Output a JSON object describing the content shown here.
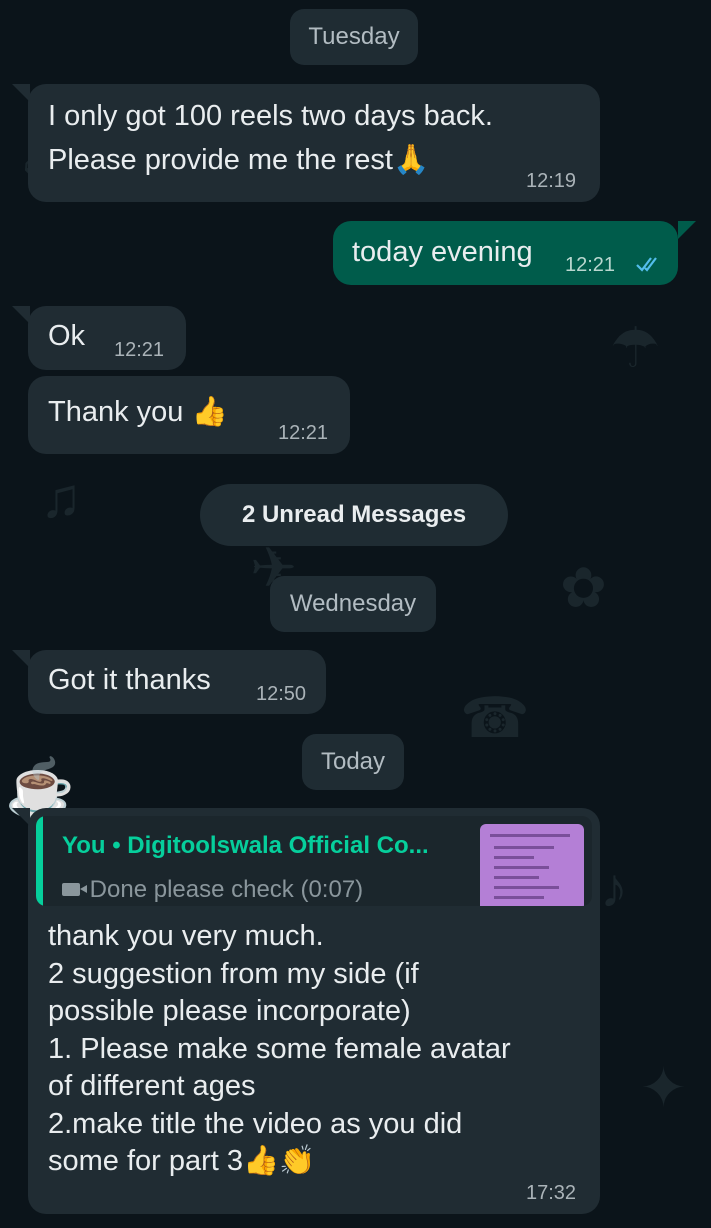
{
  "chat": {
    "date_tuesday": "Tuesday",
    "msg1": {
      "line1": "I only got 100 reels two days back.",
      "line2": "Please provide me the rest🙏",
      "time": "12:19"
    },
    "msg2": {
      "text": "today evening",
      "time": "12:21",
      "status_icon": "double-check-icon"
    },
    "msg3": {
      "text": "Ok",
      "time": "12:21"
    },
    "msg4": {
      "text": "Thank you 👍",
      "time": "12:21"
    },
    "unread_banner": "2 Unread Messages",
    "date_wednesday": "Wednesday",
    "msg5": {
      "text": "Got it thanks",
      "time": "12:50"
    },
    "date_today": "Today",
    "msg6": {
      "reply": {
        "title": "You • Digitoolswala Official Co...",
        "subtitle": "Done please check (0:07)",
        "media_icon": "video-camera-icon"
      },
      "lines": [
        "thank you very much.",
        "2 suggestion from my side (if",
        "possible please incorporate)",
        "1. Please make some female avatar",
        "of different ages",
        "2.make title the video as you did",
        "some for part 3👍👏"
      ],
      "time": "17:32"
    }
  },
  "colors": {
    "background": "#0b141a",
    "incoming_bubble": "#202c33",
    "outgoing_bubble": "#005c4b",
    "reply_accent": "#06cf9c",
    "read_ticks": "#53bdeb"
  }
}
